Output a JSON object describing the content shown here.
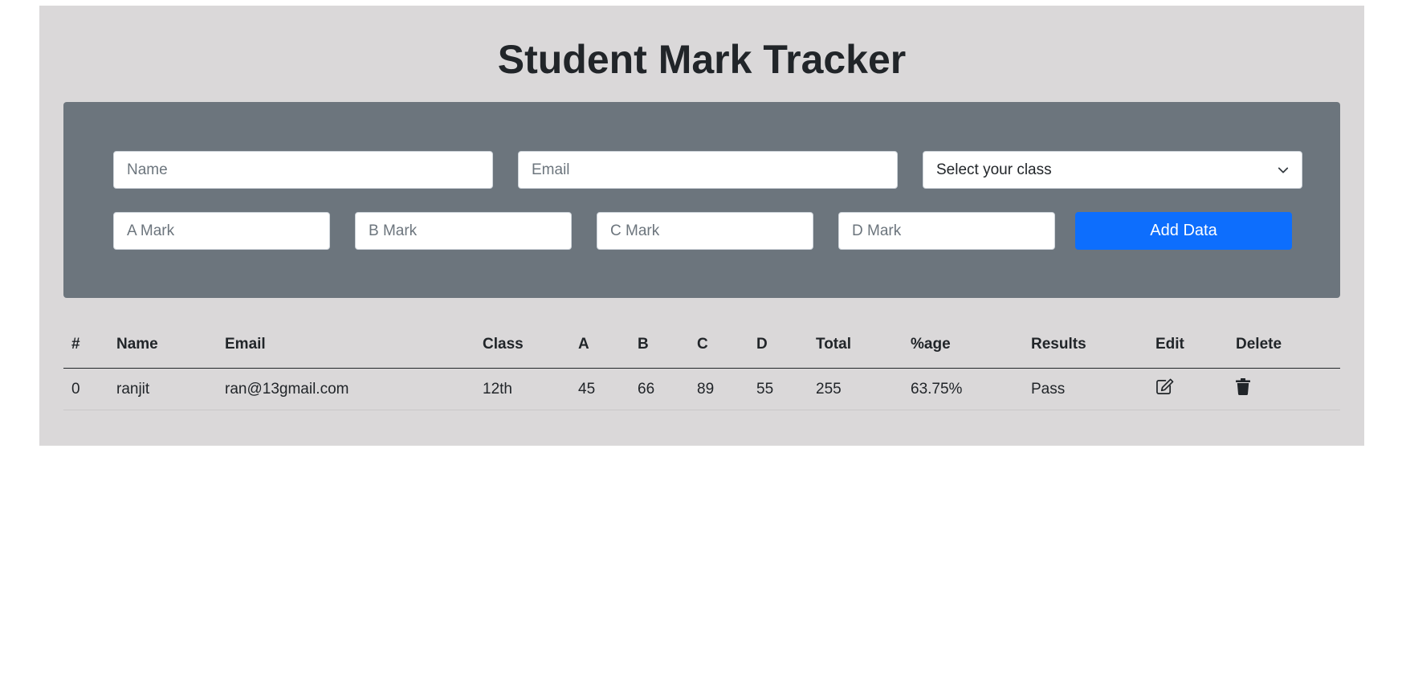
{
  "header": {
    "title": "Student Mark Tracker"
  },
  "form": {
    "name_placeholder": "Name",
    "email_placeholder": "Email",
    "class_select": {
      "selected": "Select your class"
    },
    "a_mark_placeholder": "A Mark",
    "b_mark_placeholder": "B Mark",
    "c_mark_placeholder": "C Mark",
    "d_mark_placeholder": "D Mark",
    "add_button_label": "Add Data"
  },
  "table": {
    "columns": [
      "#",
      "Name",
      "Email",
      "Class",
      "A",
      "B",
      "C",
      "D",
      "Total",
      "%age",
      "Results",
      "Edit",
      "Delete"
    ],
    "rows": [
      {
        "index": "0",
        "name": "ranjit",
        "email": "ran@13gmail.com",
        "class": "12th",
        "a": "45",
        "b": "66",
        "c": "89",
        "d": "55",
        "total": "255",
        "percentage": "63.75%",
        "result": "Pass",
        "edit_icon": "edit-icon",
        "delete_icon": "trash-icon"
      }
    ]
  },
  "colors": {
    "page_background": "#dad8d9",
    "form_panel": "#6c757d",
    "primary_button": "#0d6efd"
  }
}
